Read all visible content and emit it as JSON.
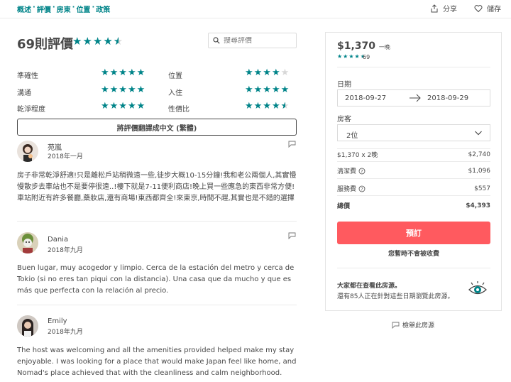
{
  "nav": {
    "links": [
      "概述",
      "評價",
      "房東",
      "位置",
      "政策"
    ],
    "share_label": "分享",
    "save_label": "儲存"
  },
  "reviews_header": {
    "title": "69則評價",
    "overall_rating": 4.5,
    "search_placeholder": "搜尋評價"
  },
  "categories": [
    {
      "label": "準確性",
      "rating": 5
    },
    {
      "label": "位置",
      "rating": 4
    },
    {
      "label": "溝通",
      "rating": 5
    },
    {
      "label": "入住",
      "rating": 5
    },
    {
      "label": "乾淨程度",
      "rating": 5
    },
    {
      "label": "性價比",
      "rating": 4.5
    }
  ],
  "translate_button": "將評價翻譯成中文 (繁體)",
  "reviews": [
    {
      "name": "苑嵐",
      "date": "2018年一月",
      "text": "房子非常乾淨舒適!只是離松戶站稍微遠一些,徒步大概10-15分鐘!我和老公兩個人,其實慢慢散步去車站也不是要停很遠..!樓下就是7-11便利商店!晚上買一些應急的東西非常方便!車站附近有許多餐廳,藥妝店,還有商場!東西都齊全!來東京,時間不趕,其實也是不錯的選擇"
    },
    {
      "name": "Dania",
      "date": "2018年九月",
      "text": "Buen lugar, muy acogedor y limpio. Cerca de la estación del metro y cerca de Tokio (si no eres tan piqui con la distancia). Una casa que da mucho y que es más que perfecta con la relación al precio."
    },
    {
      "name": "Emily",
      "date": "2018年九月",
      "text": "The host was welcoming and all the amenities provided helped make my stay enjoyable. I was looking for a place that would make Japan feel like home, and Nomad's place achieved that with the cleanliness and calm neighborhood."
    }
  ],
  "booking": {
    "price": "$1,370",
    "per": "一晚",
    "rating": 4.5,
    "review_count": "69",
    "dates_label": "日期",
    "checkin": "2018-09-27",
    "checkout": "2018-09-29",
    "guests_label": "房客",
    "guests_value": "2位",
    "lines": [
      {
        "label": "$1,370 x 2晚",
        "amount": "$2,740",
        "info": false
      },
      {
        "label": "清潔費",
        "amount": "$1,096",
        "info": true
      },
      {
        "label": "服務費",
        "amount": "$557",
        "info": true
      },
      {
        "label": "總價",
        "amount": "$4,393",
        "info": false
      }
    ],
    "reserve_label": "預訂",
    "no_charge": "您暫時不會被收費",
    "popular_title": "大家都在查看此房源。",
    "popular_sub": "還有85人正在針對這些日期瀏覽此房源。",
    "accent": "#ff5a5f",
    "teal": "#008489"
  },
  "report_label": "檢舉此房源"
}
